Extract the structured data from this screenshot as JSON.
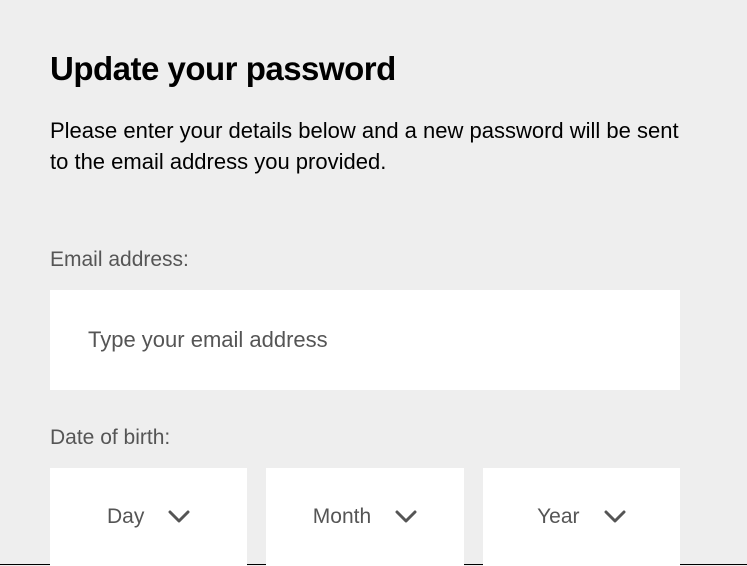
{
  "header": {
    "title": "Update your password",
    "description": "Please enter your details below and a new password will be sent to the email address you provided."
  },
  "form": {
    "email": {
      "label": "Email address:",
      "placeholder": "Type your email address",
      "value": ""
    },
    "dob": {
      "label": "Date of birth:",
      "day": "Day",
      "month": "Month",
      "year": "Year"
    }
  }
}
